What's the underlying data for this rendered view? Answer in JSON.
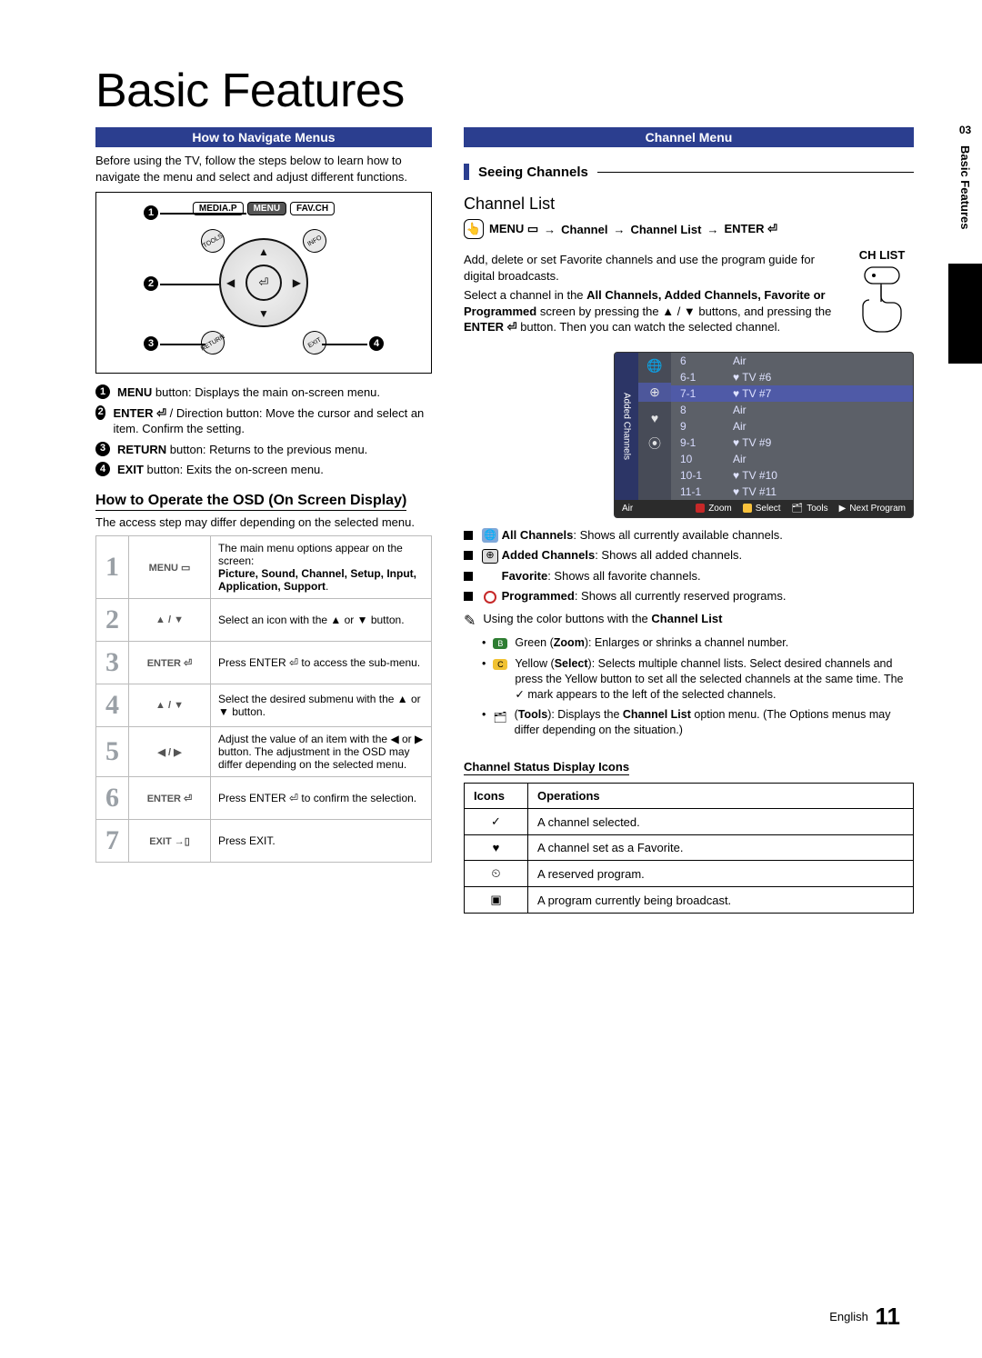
{
  "section_tab": {
    "num": "03",
    "label": "Basic Features"
  },
  "title": "Basic Features",
  "left": {
    "bar": "How to Navigate Menus",
    "intro": "Before using the TV, follow the steps below to learn how to navigate the menu and select and adjust different functions.",
    "remote_buttons": {
      "media": "MEDIA.P",
      "menu": "MENU",
      "fav": "FAV.CH"
    },
    "callouts": [
      {
        "n": "1",
        "bold": "MENU",
        "text": " button: Displays the main on-screen menu."
      },
      {
        "n": "2",
        "bold": "ENTER ⏎",
        "text": " / Direction button: Move the cursor and select an item. Confirm the setting."
      },
      {
        "n": "3",
        "bold": "RETURN",
        "text": " button: Returns to the previous menu."
      },
      {
        "n": "4",
        "bold": "EXIT",
        "text": " button: Exits the on-screen menu."
      }
    ],
    "osd_heading": "How to Operate the OSD (On Screen Display)",
    "osd_note": "The access step may differ depending on the selected menu.",
    "steps": [
      {
        "n": "1",
        "btn": "MENU ▭",
        "desc_pre": "The main menu options appear on the screen:",
        "desc_bold": "Picture, Sound, Channel, Setup, Input, Application, Support",
        "desc_post": "."
      },
      {
        "n": "2",
        "btn": "▲ / ▼",
        "desc": "Select an icon with the ▲ or ▼ button."
      },
      {
        "n": "3",
        "btn": "ENTER ⏎",
        "desc": "Press ENTER ⏎ to access the sub-menu."
      },
      {
        "n": "4",
        "btn": "▲ / ▼",
        "desc": "Select the desired submenu with the ▲ or ▼ button."
      },
      {
        "n": "5",
        "btn": "◀ / ▶",
        "desc": "Adjust the value of an item with the ◀ or ▶ button. The adjustment in the OSD may differ depending on the selected menu."
      },
      {
        "n": "6",
        "btn": "ENTER ⏎",
        "desc": "Press ENTER ⏎ to confirm the selection."
      },
      {
        "n": "7",
        "btn": "EXIT →▯",
        "desc": "Press EXIT."
      }
    ]
  },
  "right": {
    "bar": "Channel Menu",
    "section": "Seeing Channels",
    "subhead": "Channel List",
    "path": {
      "menu": "MENU ▭",
      "arrow": "→",
      "seg1": "Channel",
      "seg2": "Channel List",
      "enter": "ENTER ⏎"
    },
    "desc1": "Add, delete or set Favorite channels and use the program guide for digital broadcasts.",
    "desc2_pre": "Select a channel in the ",
    "desc2_bold": "All Channels, Added Channels, Favorite or Programmed",
    "desc2_mid": " screen by pressing the ▲ / ▼ buttons, and pressing the ",
    "desc2_bold2": "ENTER ⏎",
    "desc2_post": " button. Then you can watch the selected channel.",
    "chlist_label": "CH LIST",
    "panel": {
      "tab": "Added Channels",
      "rows": [
        {
          "num": "6",
          "name": "Air"
        },
        {
          "num": "6-1",
          "name": "♥ TV #6"
        },
        {
          "num": "7-1",
          "name": "♥ TV #7",
          "sel": true
        },
        {
          "num": "8",
          "name": "Air"
        },
        {
          "num": "9",
          "name": "Air"
        },
        {
          "num": "9-1",
          "name": "♥ TV #9"
        },
        {
          "num": "10",
          "name": "Air"
        },
        {
          "num": "10-1",
          "name": "♥ TV #10"
        },
        {
          "num": "11-1",
          "name": "♥ TV #11"
        }
      ],
      "footer_left": "Air",
      "legends": [
        "Zoom",
        "Select",
        "Tools",
        "Next Program"
      ]
    },
    "bullets": [
      {
        "icon": "all",
        "bold": "All Channels",
        "text": ": Shows all currently available channels."
      },
      {
        "icon": "add",
        "bold": "Added Channels",
        "text": ": Shows all added channels."
      },
      {
        "icon": "fav",
        "bold": "Favorite",
        "text": ": Shows all favorite channels."
      },
      {
        "icon": "prog",
        "bold": "Programmed",
        "text": ": Shows all currently reserved programs."
      }
    ],
    "color_note": "Using the color buttons with the ",
    "color_note_bold": "Channel List",
    "color_items": [
      {
        "kind": "green",
        "label": "B",
        "bold": "Zoom",
        "text": "Green (Zoom): Enlarges or shrinks a channel number."
      },
      {
        "kind": "yellow",
        "label": "C",
        "bold": "Select",
        "text": "Yellow (Select): Selects multiple channel lists. Select desired channels and press the Yellow button to set all the selected channels at the same time. The ✓ mark appears to the left of the selected channels."
      },
      {
        "kind": "tools",
        "label": "🗂",
        "bold": "Tools",
        "text": "(Tools): Displays the Channel List option menu. (The Options menus may differ depending on the situation.)"
      }
    ],
    "status_heading": "Channel Status Display Icons",
    "status_table": {
      "head": [
        "Icons",
        "Operations"
      ],
      "rows": [
        {
          "icon": "✓",
          "op": "A channel selected."
        },
        {
          "icon": "♥",
          "op": "A channel set as a Favorite."
        },
        {
          "icon": "⏲",
          "op": "A reserved program."
        },
        {
          "icon": "▣",
          "op": "A program currently being broadcast."
        }
      ]
    }
  },
  "footer": {
    "lang": "English",
    "page": "11"
  }
}
